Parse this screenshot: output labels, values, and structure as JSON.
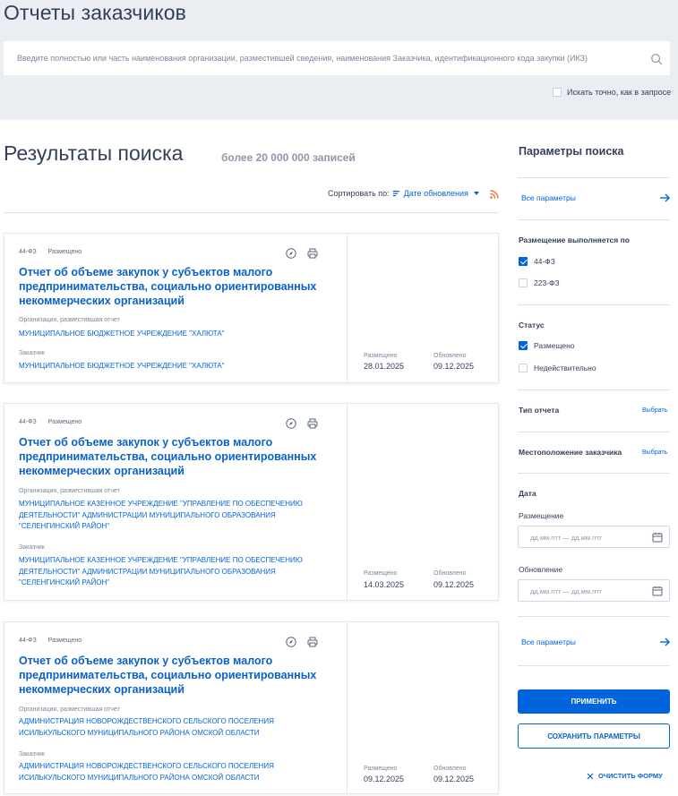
{
  "header": {
    "title": "Отчеты заказчиков",
    "search_placeholder": "Введите полностью или часть наименования организации, разместившей сведения, наименования Заказчика, идентификационного кода закупки (ИКЗ)",
    "exact_label": "Искать точно, как в запросе"
  },
  "results": {
    "title": "Результаты поиска",
    "count": "более 20 000 000 записей",
    "sort_label": "Сортировать по:",
    "sort_value": "Дате обновления"
  },
  "cards": [
    {
      "law": "44-ФЗ",
      "status": "Размещено",
      "title": "Отчет об объеме закупок у субъектов малого предпринимательства, социально ориентированных некоммерческих организаций",
      "org_label": "Организация, разместившая отчет",
      "org": "МУНИЦИПАЛЬНОЕ БЮДЖЕТНОЕ УЧРЕЖДЕНИЕ \"ХАЛЮТА\"",
      "customer_label": "Заказчик",
      "customer": "МУНИЦИПАЛЬНОЕ БЮДЖЕТНОЕ УЧРЕЖДЕНИЕ \"ХАЛЮТА\"",
      "posted_label": "Размещено",
      "posted": "28.01.2025",
      "updated_label": "Обновлено",
      "updated": "09.12.2025"
    },
    {
      "law": "44-ФЗ",
      "status": "Размещено",
      "title": "Отчет об объеме закупок у субъектов малого предпринимательства, социально ориентированных некоммерческих организаций",
      "org_label": "Организация, разместившая отчет",
      "org": "МУНИЦИПАЛЬНОЕ КАЗЕННОЕ УЧРЕЖДЕНИЕ \"УПРАВЛЕНИЕ ПО ОБЕСПЕЧЕНИЮ ДЕЯТЕЛЬНОСТИ\" АДМИНИСТРАЦИИ МУНИЦИПАЛЬНОГО ОБРАЗОВАНИЯ \"СЕЛЕНГИНСКИЙ РАЙОН\"",
      "customer_label": "Заказчик",
      "customer": "МУНИЦИПАЛЬНОЕ КАЗЕННОЕ УЧРЕЖДЕНИЕ \"УПРАВЛЕНИЕ ПО ОБЕСПЕЧЕНИЮ ДЕЯТЕЛЬНОСТИ\" АДМИНИСТРАЦИИ МУНИЦИПАЛЬНОГО ОБРАЗОВАНИЯ \"СЕЛЕНГИНСКИЙ РАЙОН\"",
      "posted_label": "Размещено",
      "posted": "14.03.2025",
      "updated_label": "Обновлено",
      "updated": "09.12.2025"
    },
    {
      "law": "44-ФЗ",
      "status": "Размещено",
      "title": "Отчет об объеме закупок у субъектов малого предпринимательства, социально ориентированных некоммерческих организаций",
      "org_label": "Организация, разместившая отчет",
      "org": "АДМИНИСТРАЦИЯ НОВОРОЖДЕСТВЕНСКОГО СЕЛЬСКОГО ПОСЕЛЕНИЯ ИСИЛЬКУЛЬСКОГО МУНИЦИПАЛЬНОГО РАЙОНА ОМСКОЙ ОБЛАСТИ",
      "customer_label": "Заказчик",
      "customer": "АДМИНИСТРАЦИЯ НОВОРОЖДЕСТВЕНСКОГО СЕЛЬСКОГО ПОСЕЛЕНИЯ ИСИЛЬКУЛЬСКОГО МУНИЦИПАЛЬНОГО РАЙОНА ОМСКОЙ ОБЛАСТИ",
      "posted_label": "Размещено",
      "posted": "09.12.2025",
      "updated_label": "Обновлено",
      "updated": "09.12.2025"
    }
  ],
  "sidebar": {
    "title": "Параметры поиска",
    "all_params": "Все параметры",
    "placement_head": "Размещение выполняется по",
    "law44": "44-ФЗ",
    "law44_checked": true,
    "law223": "223-ФЗ",
    "law223_checked": false,
    "status_head": "Статус",
    "status_posted": "Размещено",
    "status_posted_checked": true,
    "status_invalid": "Недействительно",
    "status_invalid_checked": false,
    "report_type": "Тип отчета",
    "location": "Местоположение заказчика",
    "pick": "Выбрать",
    "date_head": "Дата",
    "date_posted": "Размещение",
    "date_updated": "Обновление",
    "date_placeholder": "дд.мм.гггг — дд.мм.гггг",
    "apply": "ПРИМЕНИТЬ",
    "save": "СОХРАНИТЬ ПАРАМЕТРЫ",
    "clear": "ОЧИСТИТЬ ФОРМУ"
  },
  "colors": {
    "accent": "#0065dd",
    "header_bg": "#eaedf1",
    "text": "#334059",
    "rss": "#f26522"
  },
  "icons": {
    "search": "search-icon",
    "sort": "sort-icon",
    "rss": "rss-icon",
    "card_action": "compass-icon",
    "print": "print-icon",
    "arrow": "arrow-right-icon",
    "calendar": "calendar-icon",
    "close": "close-icon"
  }
}
